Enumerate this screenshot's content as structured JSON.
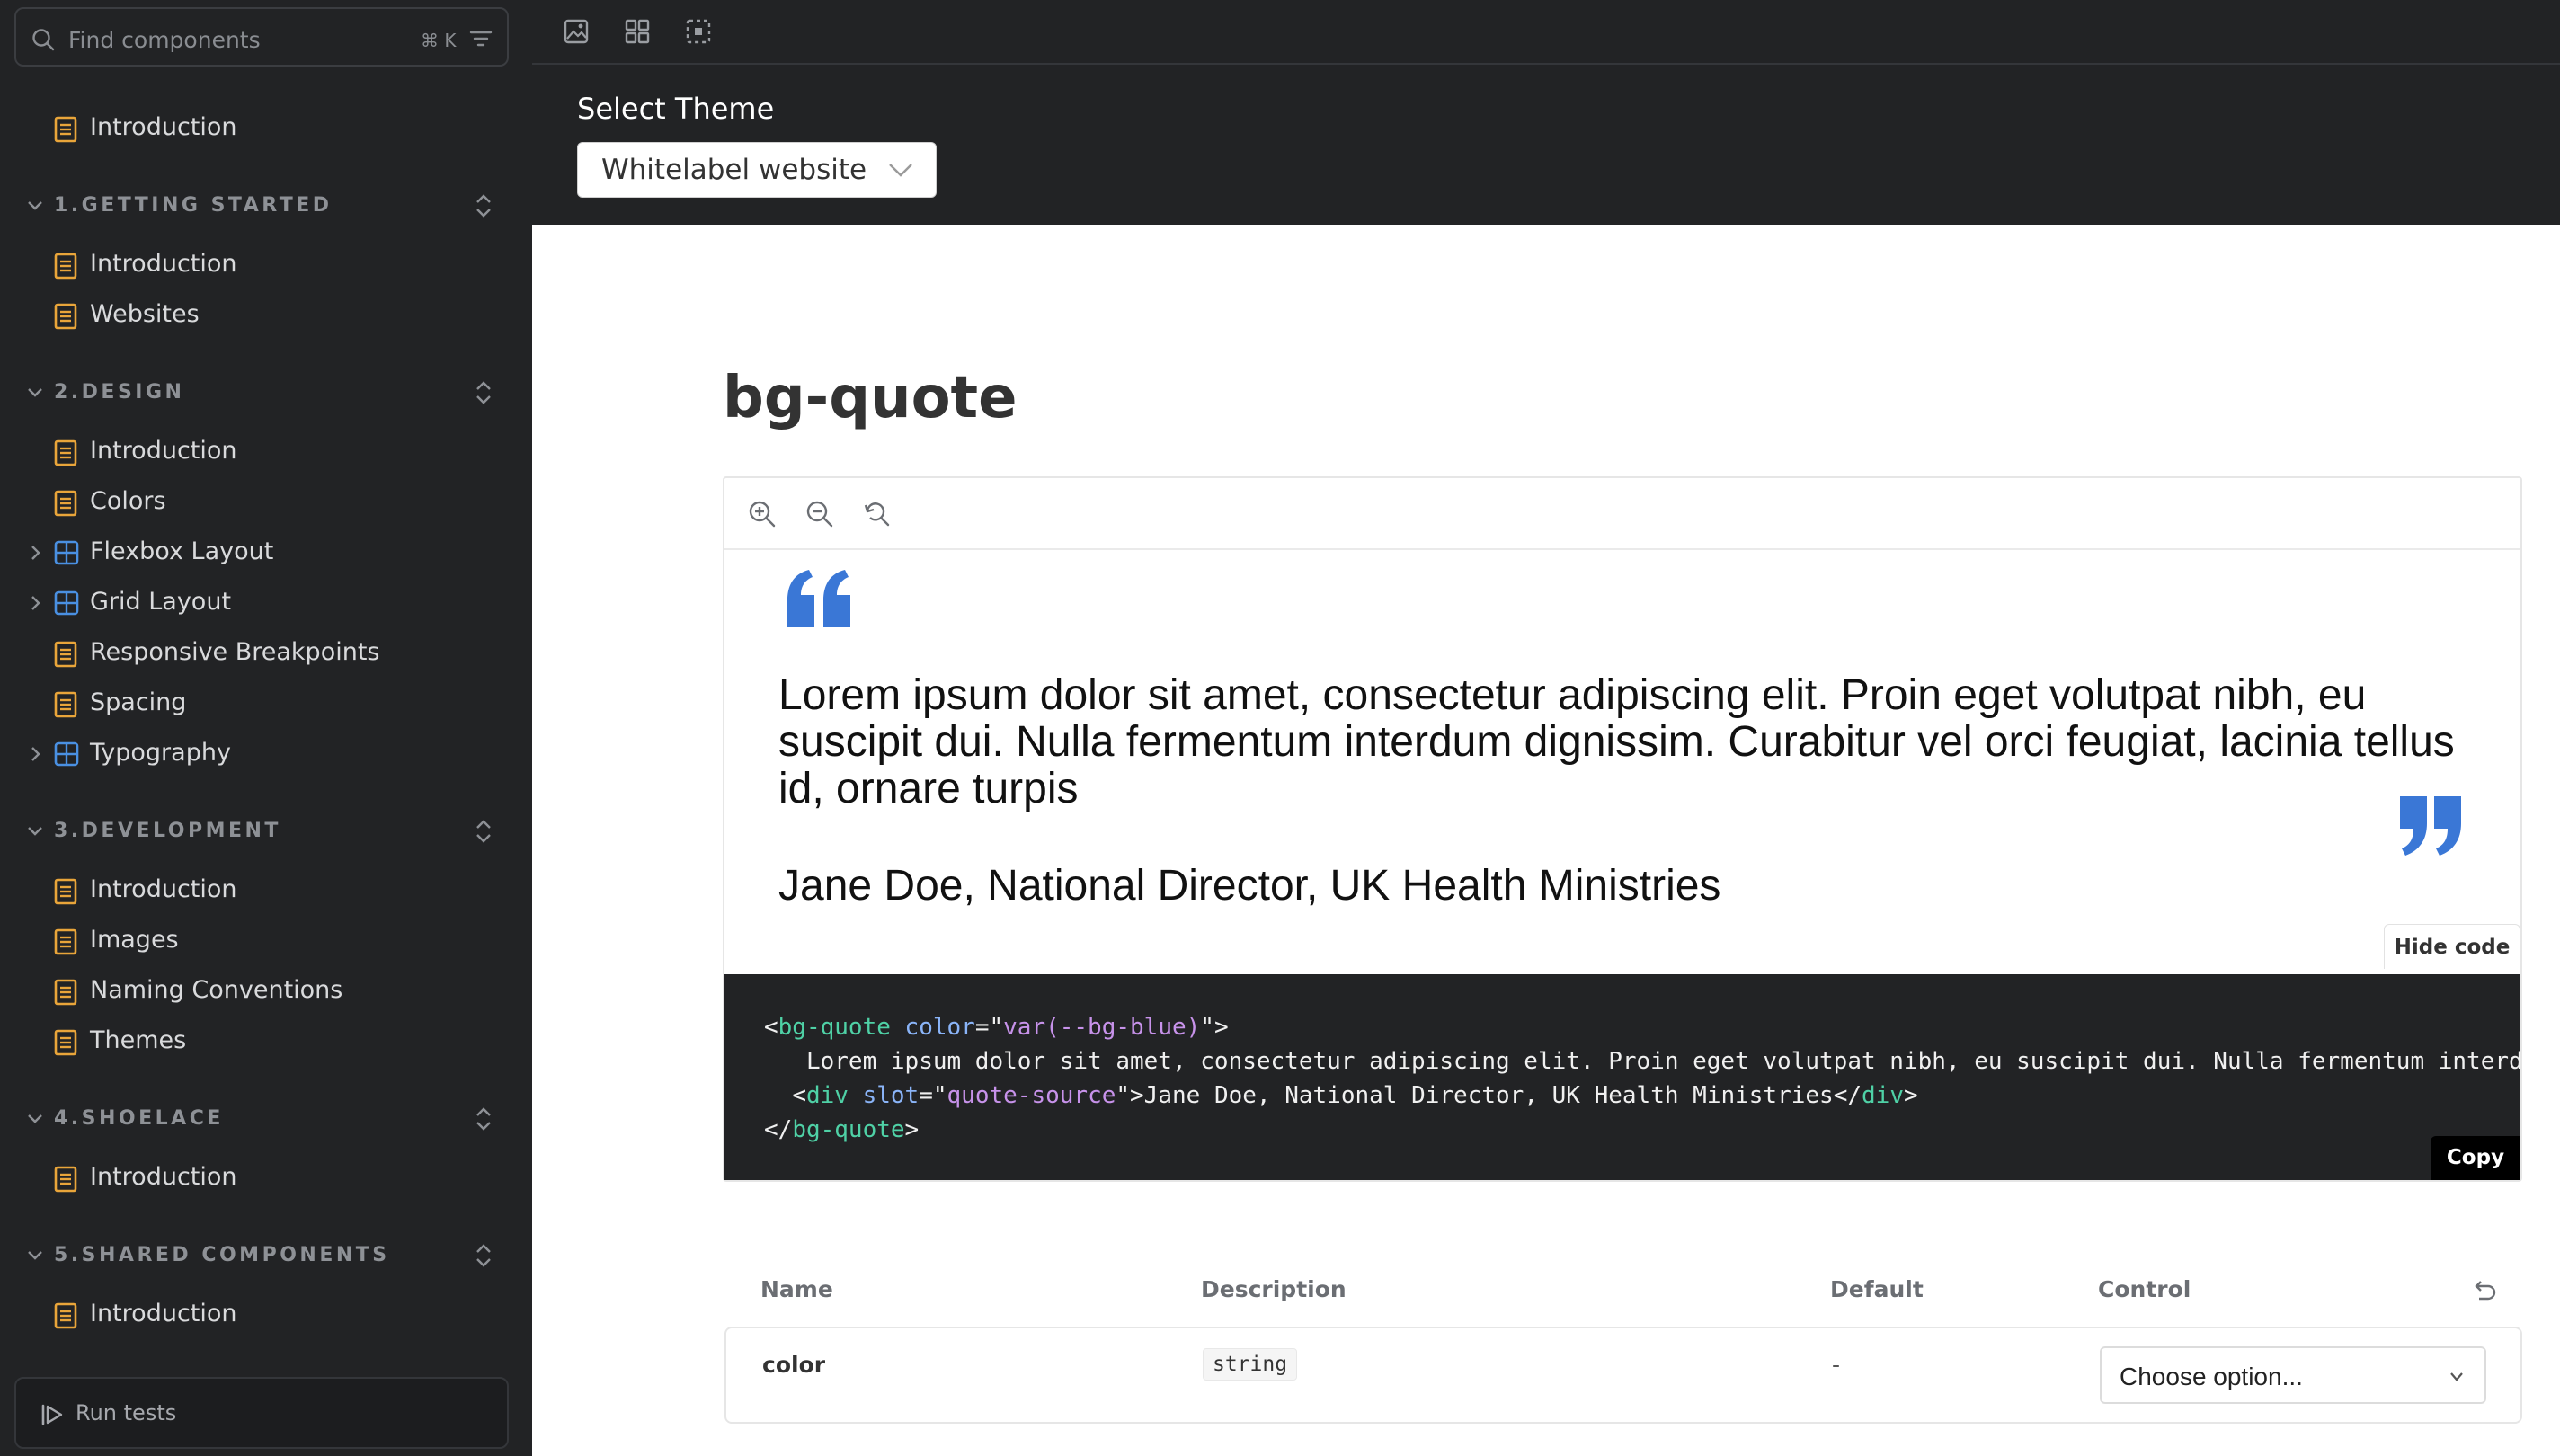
{
  "sidebar": {
    "search_placeholder": "Find components",
    "search_shortcut": "⌘ K",
    "top_item": "Introduction",
    "sections": [
      {
        "title": "1.GETTING STARTED",
        "items": [
          "Introduction",
          "Websites"
        ]
      },
      {
        "title": "2.DESIGN",
        "items": [
          "Introduction",
          "Colors",
          "Flexbox Layout",
          "Grid Layout",
          "Responsive Breakpoints",
          "Spacing",
          "Typography"
        ]
      },
      {
        "title": "3.DEVELOPMENT",
        "items": [
          "Introduction",
          "Images",
          "Naming Conventions",
          "Themes"
        ]
      },
      {
        "title": "4.SHOELACE",
        "items": [
          "Introduction"
        ]
      },
      {
        "title": "5.SHARED COMPONENTS",
        "items": [
          "Introduction"
        ]
      }
    ],
    "run_tests": "Run tests"
  },
  "toolbar": {
    "icons": [
      "image-icon",
      "grid-icon",
      "outline-icon"
    ]
  },
  "theme": {
    "label": "Select Theme",
    "selected": "Whitelabel website"
  },
  "main": {
    "title": "bg-quote",
    "zoom_icons": [
      "zoom-in-icon",
      "zoom-out-icon",
      "zoom-reset-icon"
    ],
    "preview": {
      "quote": "Lorem ipsum dolor sit amet, consectetur adipiscing elit. Proin eget volutpat nibh, eu suscipit dui. Nulla fermentum interdum dignissim. Curabitur vel orci feugiat, lacinia tellus id, ornare turpis",
      "source": "Jane Doe, National Director, UK Health Ministries",
      "accent_color": "#3a77d6"
    },
    "hide_code": "Hide code",
    "code": {
      "line1_open": "<",
      "line1_tag": "bg-quote",
      "line1_attr": "color",
      "line1_eq": "=\"",
      "line1_val": "var(--bg-blue)",
      "line1_end": "\">",
      "line2": "Lorem ipsum dolor sit amet, consectetur adipiscing elit. Proin eget volutpat nibh, eu suscipit dui. Nulla fermentum interdum dignissim.",
      "line3_open": "<",
      "line3_tag": "div",
      "line3_attr": "slot",
      "line3_eq": "=\"",
      "line3_val": "quote-source",
      "line3_mid": "\">Jane Doe, National Director, UK Health Ministries</",
      "line3_tag2": "div",
      "line3_end": ">",
      "line4_open": "</",
      "line4_tag": "bg-quote",
      "line4_end": ">"
    },
    "copy": "Copy"
  },
  "args_table": {
    "headers": {
      "name": "Name",
      "description": "Description",
      "default": "Default",
      "control": "Control"
    },
    "rows": [
      {
        "name": "color",
        "type": "string",
        "default": "-",
        "control": "Choose option..."
      }
    ]
  },
  "colors": {
    "sidebar_bg": "#222325",
    "doc_icon": "#e9a53a",
    "component_icon": "#4a90e2",
    "quote_accent": "#3a77d6"
  }
}
